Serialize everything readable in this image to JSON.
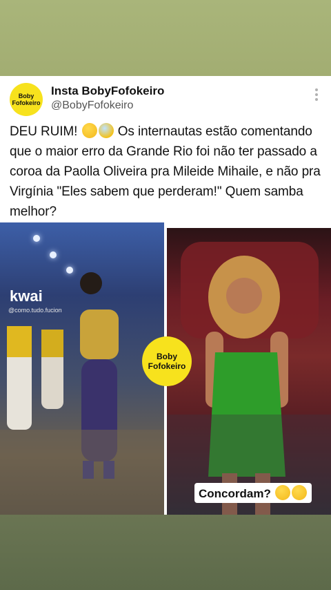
{
  "post": {
    "display_name": "Insta BobyFofokeiro",
    "handle": "@BobyFofokeiro",
    "avatar_line1": "Boby",
    "avatar_line2": "Fofokeiro",
    "text_part1": "DEU RUIM! ",
    "emoji1": "thinking-face",
    "emoji2": "screaming-face",
    "text_part2": " Os internautas estão comentando que o maior erro da Grande Rio foi não ter passado a coroa da Paolla Oliveira pra Mileide Mihaile, e não pra Virgínia \"Eles sabem que perderam!\" Quem samba melhor?"
  },
  "media": {
    "watermark": "kwai",
    "watermark_sub": "@como.tudo.fucion",
    "badge_line1": "Boby",
    "badge_line2": "Fofokeiro",
    "caption_text": "Concordam? ",
    "caption_emojis": [
      "thinking-face",
      "thinking-face"
    ],
    "dress_color": "#2e9d2a",
    "outfit_color": "#2a2f7a"
  }
}
